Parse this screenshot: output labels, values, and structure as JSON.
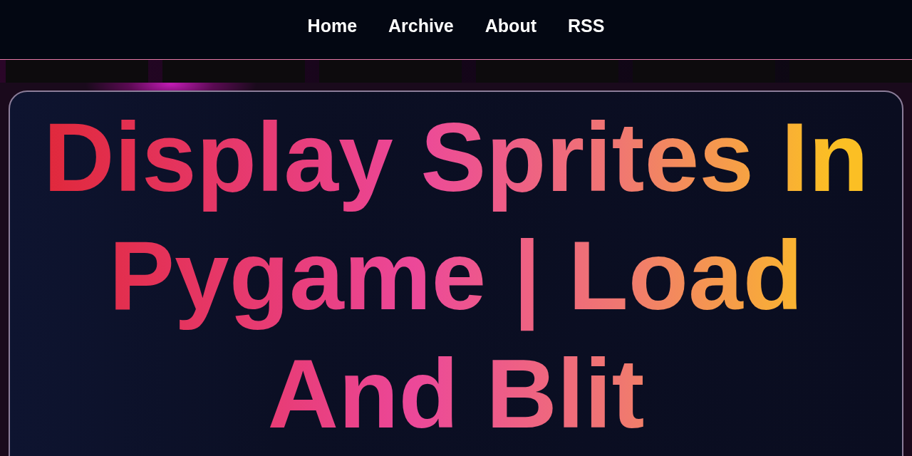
{
  "nav": [
    {
      "label": "Home"
    },
    {
      "label": "Archive"
    },
    {
      "label": "About"
    },
    {
      "label": "RSS"
    }
  ],
  "article": {
    "title": "Display Sprites In Pygame | Load And Blit"
  }
}
